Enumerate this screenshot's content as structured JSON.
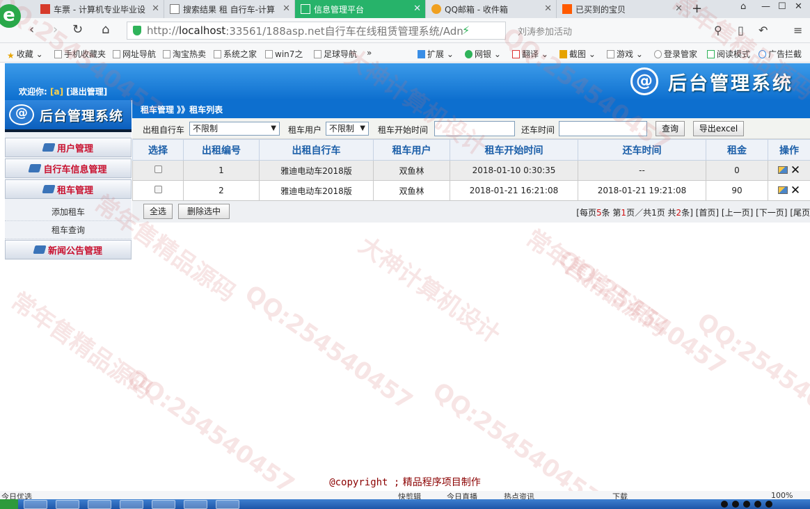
{
  "browser": {
    "logo_letter": "e",
    "tabs": [
      {
        "label": "车票 - 计算机专业毕业设",
        "fav_color": "#d63a2a"
      },
      {
        "label": "搜索结果 租 自行车-计算",
        "fav_color": "#ffffff"
      },
      {
        "label": "信息管理平台",
        "fav_color": "#ffffff"
      },
      {
        "label": "QQ邮箱 - 收件箱",
        "fav_color": "#f0a020"
      },
      {
        "label": "已买到的宝贝",
        "fav_color": "#ff5a00"
      }
    ],
    "new_tab": "+",
    "address": {
      "prefix": "http://",
      "host": "localhost",
      "rest": ":33561/188asp.net自行车在线租赁管理系统/Adn"
    },
    "search_text": "刘涛参加活动",
    "bookmarks": [
      "收藏",
      "手机收藏夹",
      "网址导航",
      "淘宝热卖",
      "系统之家",
      "win7之",
      "足球导航",
      "»",
      "扩展",
      "网银",
      "翻译",
      "截图",
      "游戏",
      "登录管家",
      "阅读模式",
      "广告拦截"
    ]
  },
  "header": {
    "welcome_label": "欢迎你:",
    "user": "[a]",
    "logout": "[退出管理]",
    "logo_at": "@",
    "title": "后台管理系统"
  },
  "sidebar": {
    "logo_title": "后台管理系统",
    "menu": {
      "user_mgmt": "用户管理",
      "bike_info": "自行车信息管理",
      "rent_mgmt": "租车管理",
      "add_rent": "添加租车",
      "rent_query": "租车查询",
      "news": "新闻公告管理"
    }
  },
  "breadcrumb": "租车管理 》》租车列表",
  "filters": {
    "bike_label": "出租自行车",
    "bike_value": "不限制",
    "user_label": "租车用户",
    "user_value": "不限制",
    "start_label": "租车开始时间",
    "end_label": "还车时间",
    "query_btn": "查询",
    "export_btn": "导出excel"
  },
  "table": {
    "headers": [
      "选择",
      "出租编号",
      "出租自行车",
      "租车用户",
      "租车开始时间",
      "还车时间",
      "租金",
      "操作"
    ],
    "rows": [
      {
        "id": "1",
        "bike": "雅迪电动车2018版",
        "user": "双鱼林",
        "start": "2018-01-10 0:30:35",
        "end": "--",
        "rent": "0"
      },
      {
        "id": "2",
        "bike": "雅迪电动车2018版",
        "user": "双鱼林",
        "start": "2018-01-21 16:21:08",
        "end": "2018-01-21 19:21:08",
        "rent": "90"
      }
    ]
  },
  "actions": {
    "select_all": "全选",
    "delete_selected": "删除选中"
  },
  "pager": {
    "p1": "[每页",
    "per_page": "5",
    "p2": "条 第",
    "current": "1",
    "p3": "页／共",
    "total_pages": "1",
    "p4": "页 共",
    "total": "2",
    "p5": "条]",
    "first": "[首页]",
    "prev": "[上一页]",
    "next": "[下一页]",
    "last": "[尾页"
  },
  "footer": {
    "copyright": "@copyright ;",
    "credit": "精品程序项目制作"
  },
  "statusbar": {
    "left": "今日优选",
    "items": [
      "快剪辑",
      "今日直播",
      "热点资讯",
      "下载",
      "100%"
    ]
  },
  "watermarks": [
    "QQ:254540457",
    "大神计算机设计",
    "常年售精品源码"
  ]
}
